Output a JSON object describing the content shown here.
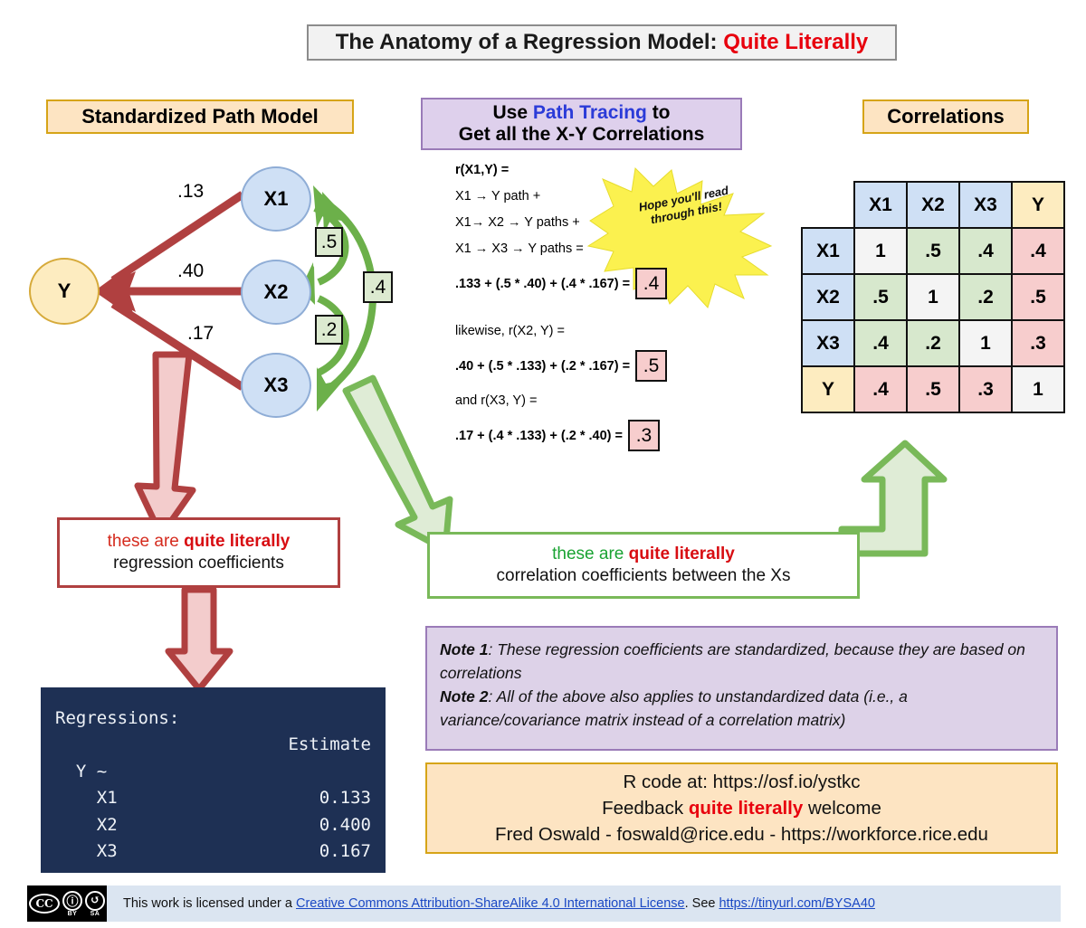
{
  "title": {
    "main": "The Anatomy of a Regression Model: ",
    "accent": "Quite Literally"
  },
  "headers": {
    "path_model": "Standardized Path Model",
    "correlations": "Correlations",
    "tracing_line1_a": "Use ",
    "tracing_line1_b": "Path Tracing",
    "tracing_line1_c": " to",
    "tracing_line2": "Get all the X-Y Correlations"
  },
  "path_model": {
    "nodes": {
      "x1": "X1",
      "x2": "X2",
      "x3": "X3",
      "y": "Y"
    },
    "coefficients": {
      "x1_y": ".13",
      "x2_y": ".40",
      "x3_y": ".17"
    },
    "correlations": {
      "x1_x2": ".5",
      "x2_x3": ".2",
      "x1_x3": ".4"
    }
  },
  "tracing": {
    "l1": "r(X1,Y) =",
    "l2": "X1 → Y path +",
    "l3": "X1→ X2 → Y paths +",
    "l4": "X1 → X3 → Y paths =",
    "l5": ".133 + (.5 * .40) + (.4 * .167) =",
    "a1": ".4",
    "l6": "likewise, r(X2, Y) =",
    "l7": ".40 + (.5 * .133) + (.2 * .167) =",
    "a2": ".5",
    "l8": "and r(X3, Y) =",
    "l9": ".17 + (.4 * .133) + (.2 * .40) =",
    "a3": ".3",
    "starburst": "Hope you'll read through this!"
  },
  "chart_data": {
    "type": "table",
    "title": "Correlations",
    "columns": [
      "",
      "X1",
      "X2",
      "X3",
      "Y"
    ],
    "rows": [
      {
        "label": "X1",
        "values": [
          "1",
          ".5",
          ".4",
          ".4"
        ]
      },
      {
        "label": "X2",
        "values": [
          ".5",
          "1",
          ".2",
          ".5"
        ]
      },
      {
        "label": "X3",
        "values": [
          ".4",
          ".2",
          "1",
          ".3"
        ]
      },
      {
        "label": "Y",
        "values": [
          ".4",
          ".5",
          ".3",
          "1"
        ]
      }
    ],
    "cell_colors": {
      "diagonal": "#f4f4f4",
      "x_x": "#d7e8cd",
      "x_y": "#f7cdcd",
      "header_x": "#cfe0f5",
      "header_y": "#fdecc0"
    }
  },
  "callouts": {
    "red": {
      "l1_a": "these are ",
      "l1_b": "quite literally",
      "l2": "regression coefficients"
    },
    "green": {
      "l1_a": "these are ",
      "l1_b": "quite literally",
      "l2": "correlation coefficients between the Xs"
    }
  },
  "r_output": {
    "heading": "Regressions:",
    "col_header": "Estimate",
    "formula": "  Y ~",
    "rows": [
      {
        "name": "    X1",
        "estimate": "0.133"
      },
      {
        "name": "    X2",
        "estimate": "0.400"
      },
      {
        "name": "    X3",
        "estimate": "0.167"
      }
    ]
  },
  "notes": {
    "note1_label": "Note 1",
    "note1_text": ": These regression coefficients are standardized, because they are based on correlations",
    "note2_label": "Note 2",
    "note2_text": ": All of the above also applies to unstandardized data (i.e., a variance/covariance matrix instead of a correlation matrix)"
  },
  "contact": {
    "line1": "R code at: https://osf.io/ystkc",
    "line2_a": "Feedback ",
    "line2_b": "quite literally",
    "line2_c": " welcome",
    "line3": "Fred Oswald - foswald@rice.edu - https://workforce.rice.edu"
  },
  "footer": {
    "badge_cc": "CC",
    "badge_by_glyph": "ⓘ",
    "badge_sa_glyph": "↺",
    "badge_by": "BY",
    "badge_sa": "SA",
    "text_a": "This work is licensed under a ",
    "link1": "Creative Commons Attribution-ShareAlike 4.0 International License",
    "text_b": ". See ",
    "link2": "https://tinyurl.com/BYSA40"
  },
  "colors": {
    "red": "#b04040",
    "green": "#79b959",
    "accent_red": "#e8000d",
    "node_x": "#cfe0f5",
    "node_y": "#fdecc0",
    "purple": "#ded0ec",
    "orange": "#fde4c2",
    "terminal": "#1e3054"
  }
}
